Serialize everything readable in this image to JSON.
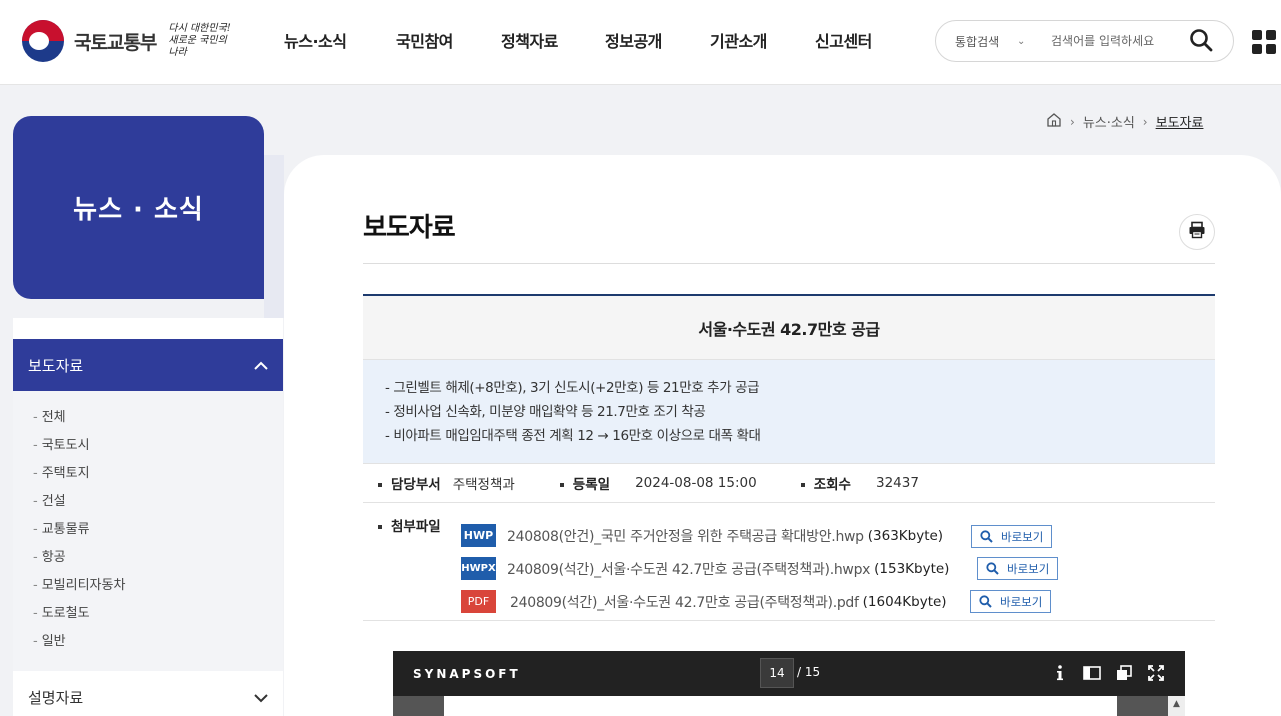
{
  "header": {
    "logo_text": "국토교통부",
    "slogan": "다시 대한민국! 새로운 국민의 나라",
    "nav": [
      "뉴스·소식",
      "국민참여",
      "정책자료",
      "정보공개",
      "기관소개",
      "신고센터"
    ],
    "search_scope": "통합검색",
    "search_placeholder": "검색어를 입력하세요"
  },
  "sidebar": {
    "title": "뉴스 · 소식",
    "active_menu": "보도자료",
    "sub_items": [
      "전체",
      "국토도시",
      "주택토지",
      "건설",
      "교통물류",
      "항공",
      "모빌리티자동차",
      "도로철도",
      "일반"
    ],
    "next_menu": "설명자료"
  },
  "breadcrumb": {
    "items": [
      "뉴스·소식",
      "보도자료"
    ]
  },
  "page": {
    "title": "보도자료"
  },
  "article": {
    "title": "서울·수도권 42.7만호 공급",
    "summary": [
      "-  그린벨트 해제(+8만호), 3기 신도시(+2만호) 등 21만호 추가 공급",
      "-  정비사업 신속화, 미분양 매입확약 등 21.7만호 조기 착공",
      "-  비아파트 매입임대주택 종전 계획 12 → 16만호 이상으로 대폭 확대"
    ],
    "meta": {
      "dept_label": "담당부서",
      "dept": "주택정책과",
      "date_label": "등록일",
      "date": "2024-08-08 15:00",
      "views_label": "조회수",
      "views": "32437"
    },
    "attach_label": "첨부파일",
    "files": [
      {
        "type": "HWP",
        "name": "240808(안건)_국민 주거안정을 위한 주택공급 확대방안.hwp",
        "size": "(363Kbyte)",
        "view": "바로보기"
      },
      {
        "type": "HWPX",
        "name": "240809(석간)_서울·수도권 42.7만호 공급(주택정책과).hwpx",
        "size": "(153Kbyte)",
        "view": "바로보기"
      },
      {
        "type": "PDF",
        "name": "240809(석간)_서울·수도권 42.7만호 공급(주택정책과).pdf",
        "size": "(1604Kbyte)",
        "view": "바로보기"
      }
    ]
  },
  "viewer": {
    "brand": "SYNAPSOFT",
    "current_page": "14",
    "total_pages": "/ 15"
  },
  "colors": {
    "primary": "#2f3c9a",
    "hwp": "#1f5dab",
    "pdf": "#d9453a"
  }
}
